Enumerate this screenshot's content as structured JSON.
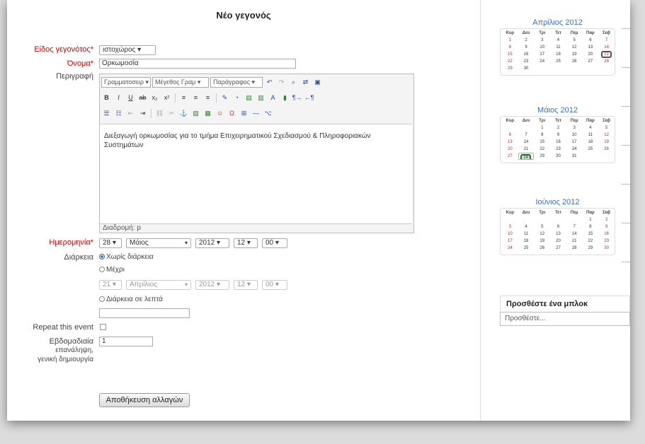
{
  "title": "Νέο γεγονός",
  "form": {
    "event_type_label": "Είδος γεγονότος",
    "event_type_value": "ιστοχώρος",
    "name_label": "Όνομα",
    "name_value": "Ορκωμοσία",
    "description_label": "Περιγραφή",
    "date_label": "Ημερομηνία",
    "duration_label": "Διάρκεια",
    "repeat_label": "Repeat this event",
    "weekly_label_1": "Εβδομαδιαία",
    "weekly_label_2": "επανάληψη,",
    "weekly_label_3": "γενική δημιουργία",
    "weekly_value": "1",
    "save_label": "Αποθήκευση αλλαγών"
  },
  "editor": {
    "font_family": "Γραμματοσειρ",
    "font_size": "Μέγεθος Γραμ",
    "format": "Παράγραφος",
    "text": "Διεξαγωγή ορκωμοσίας για το τμήμα Επιχειρηματικού Σχεδιασμού & Πληροφοριακών Συστημάτων",
    "path": "Διαδρομή: p"
  },
  "date": {
    "day": "28",
    "month": "Μάιος",
    "year": "2012",
    "hour": "12",
    "minute": "00"
  },
  "duration": {
    "option_none": "Χωρίς διάρκεια",
    "option_until": "Μέχρι",
    "until_day": "21",
    "until_month": "Απρίλιος",
    "until_year": "2012",
    "until_hour": "12",
    "until_minute": "00",
    "option_minutes": "Διάρκεια σε λεπτά"
  },
  "calendars": [
    {
      "title": "Απρίλιος 2012",
      "days": [
        "Κυρ",
        "Δευ",
        "Τρι",
        "Τετ",
        "Πεμ",
        "Παρ",
        "Σαβ"
      ],
      "weeks": [
        [
          "1",
          "2",
          "3",
          "4",
          "5",
          "6",
          "7"
        ],
        [
          "8",
          "9",
          "10",
          "11",
          "12",
          "13",
          "14"
        ],
        [
          "15",
          "16",
          "17",
          "18",
          "19",
          "20",
          "21"
        ],
        [
          "22",
          "23",
          "24",
          "25",
          "26",
          "27",
          "28"
        ],
        [
          "29",
          "30",
          "",
          "",
          "",
          "",
          ""
        ]
      ]
    },
    {
      "title": "Μάιος 2012",
      "days": [
        "Κυρ",
        "Δευ",
        "Τρι",
        "Τετ",
        "Πεμ",
        "Παρ",
        "Σαβ"
      ],
      "weeks": [
        [
          "",
          "",
          "1",
          "2",
          "3",
          "4",
          "5"
        ],
        [
          "6",
          "7",
          "8",
          "9",
          "10",
          "11",
          "12"
        ],
        [
          "13",
          "14",
          "15",
          "16",
          "17",
          "18",
          "19"
        ],
        [
          "20",
          "21",
          "22",
          "23",
          "24",
          "25",
          "26"
        ],
        [
          "27",
          "28",
          "29",
          "30",
          "31",
          "",
          ""
        ]
      ]
    },
    {
      "title": "Ιούνιος 2012",
      "days": [
        "Κυρ",
        "Δευ",
        "Τρι",
        "Τετ",
        "Πεμ",
        "Παρ",
        "Σαβ"
      ],
      "weeks": [
        [
          "",
          "",
          "",
          "",
          "",
          "1",
          "2"
        ],
        [
          "3",
          "4",
          "5",
          "6",
          "7",
          "8",
          "9"
        ],
        [
          "10",
          "11",
          "12",
          "13",
          "14",
          "15",
          "16"
        ],
        [
          "17",
          "18",
          "19",
          "20",
          "21",
          "22",
          "23"
        ],
        [
          "24",
          "25",
          "26",
          "27",
          "28",
          "29",
          "30"
        ]
      ]
    }
  ],
  "block": {
    "title": "Προσθέστε ένα μπλοκ",
    "select": "Προσθέστε..."
  }
}
